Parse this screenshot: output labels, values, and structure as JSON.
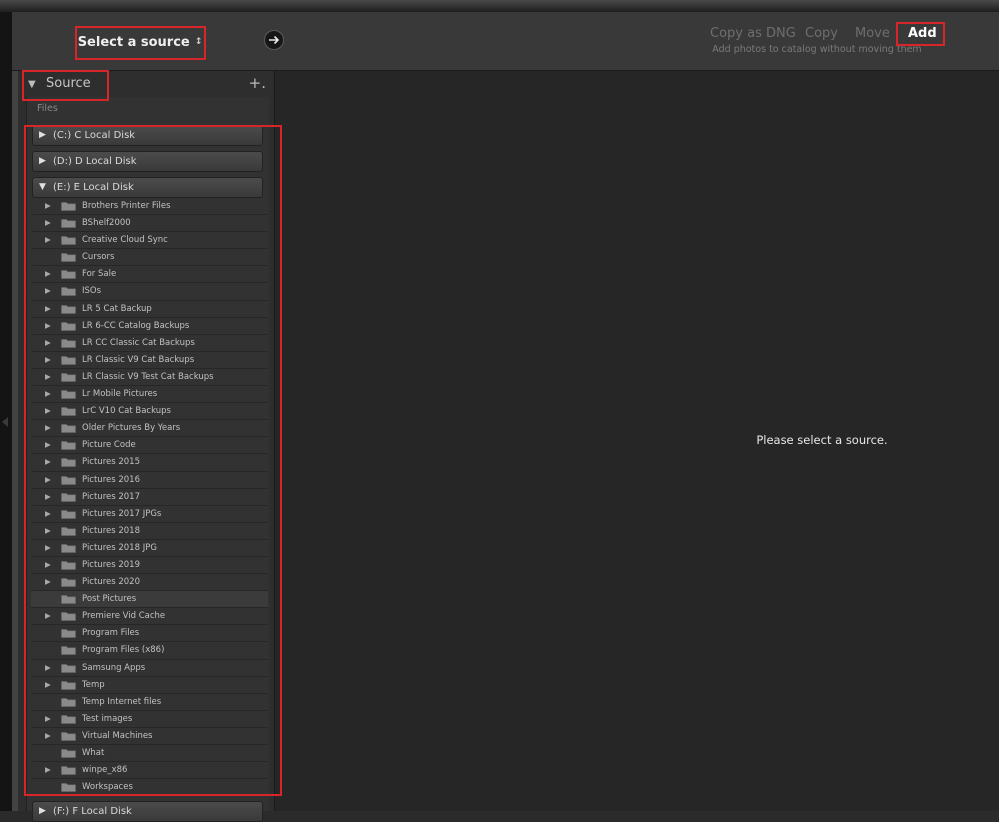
{
  "header": {
    "source_select_label": "Select a source",
    "modes": [
      "Copy as DNG",
      "Copy",
      "Move",
      "Add"
    ],
    "active_mode": "Add",
    "mode_description": "Add photos to catalog without moving them"
  },
  "source_panel": {
    "title": "Source",
    "files_label": "Files",
    "disks": [
      {
        "label": "(C:) C Local Disk",
        "expanded": false
      },
      {
        "label": "(D:) D Local Disk",
        "expanded": false
      },
      {
        "label": "(E:) E Local Disk",
        "expanded": true
      },
      {
        "label": "(F:) F Local Disk",
        "expanded": false
      }
    ],
    "folders": [
      {
        "name": "Brothers Printer Files",
        "has_children": true
      },
      {
        "name": "BShelf2000",
        "has_children": true
      },
      {
        "name": "Creative Cloud Sync",
        "has_children": true
      },
      {
        "name": "Cursors",
        "has_children": false
      },
      {
        "name": "For Sale",
        "has_children": true
      },
      {
        "name": "ISOs",
        "has_children": true
      },
      {
        "name": "LR 5 Cat Backup",
        "has_children": true
      },
      {
        "name": "LR 6-CC Catalog Backups",
        "has_children": true
      },
      {
        "name": "LR CC Classic Cat Backups",
        "has_children": true
      },
      {
        "name": "LR Classic V9 Cat Backups",
        "has_children": true
      },
      {
        "name": "LR Classic V9 Test Cat Backups",
        "has_children": true
      },
      {
        "name": "Lr Mobile Pictures",
        "has_children": true
      },
      {
        "name": "LrC V10 Cat Backups",
        "has_children": true
      },
      {
        "name": "Older Pictures By Years",
        "has_children": true
      },
      {
        "name": "Picture Code",
        "has_children": true
      },
      {
        "name": "Pictures 2015",
        "has_children": true
      },
      {
        "name": "Pictures 2016",
        "has_children": true
      },
      {
        "name": "Pictures 2017",
        "has_children": true
      },
      {
        "name": "Pictures 2017 JPGs",
        "has_children": true
      },
      {
        "name": "Pictures 2018",
        "has_children": true
      },
      {
        "name": "Pictures 2018 JPG",
        "has_children": true
      },
      {
        "name": "Pictures 2019",
        "has_children": true
      },
      {
        "name": "Pictures 2020",
        "has_children": true
      },
      {
        "name": "Post Pictures",
        "has_children": false,
        "selected": true
      },
      {
        "name": "Premiere Vid Cache",
        "has_children": true
      },
      {
        "name": "Program Files",
        "has_children": false
      },
      {
        "name": "Program Files (x86)",
        "has_children": false
      },
      {
        "name": "Samsung Apps",
        "has_children": true
      },
      {
        "name": "Temp",
        "has_children": true
      },
      {
        "name": "Temp Internet files",
        "has_children": false
      },
      {
        "name": "Test images",
        "has_children": true
      },
      {
        "name": "Virtual Machines",
        "has_children": true
      },
      {
        "name": "What",
        "has_children": false
      },
      {
        "name": "winpe_x86",
        "has_children": true
      },
      {
        "name": "Workspaces",
        "has_children": false
      }
    ]
  },
  "main": {
    "message": "Please select a source."
  },
  "icons": {
    "go": "arrow-right-circle-icon",
    "collapse": "triangle-down-icon",
    "expand": "triangle-right-icon",
    "add_source": "plus-icon",
    "folder": "folder-icon"
  },
  "colors": {
    "highlight": "#d6262a",
    "active_mode": "#ffffff",
    "inactive_mode": "#6e6e6e"
  }
}
